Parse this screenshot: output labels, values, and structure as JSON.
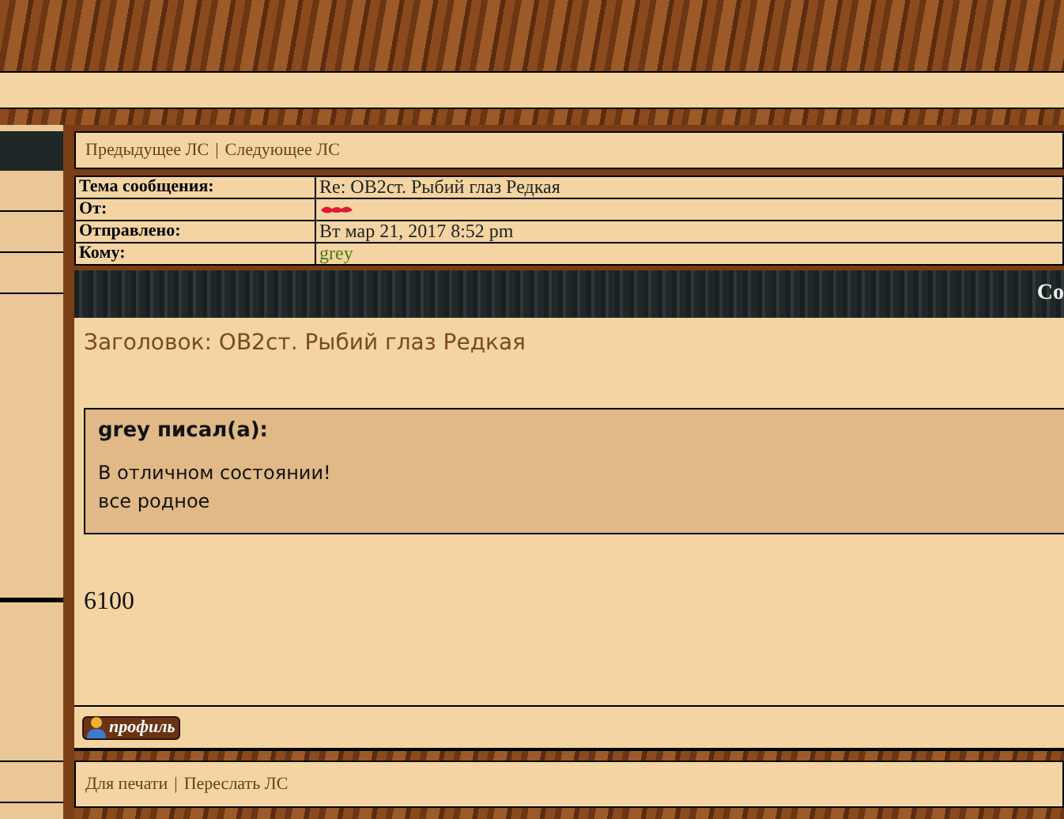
{
  "nav_links": [
    "Предыдущее ЛС",
    "Следующее ЛС"
  ],
  "nav_separator": "|",
  "header_fields": [
    {
      "label": "Тема сообщения:",
      "value": "Re: OB2ст. Рыбий глаз Редкая",
      "kind": "text"
    },
    {
      "label": "От:",
      "kind": "redacted"
    },
    {
      "label": "Отправлено:",
      "value": "Вт мар 21, 2017 8:52 pm",
      "kind": "text"
    },
    {
      "label": "Кому:",
      "value": "grey",
      "kind": "user"
    }
  ],
  "post_bar": {
    "title": "Со"
  },
  "post": {
    "subject": "Заголовок: OB2ст. Рыбий глаз Редкая",
    "quote": {
      "author": "grey писал(а):",
      "lines": [
        "В отличном состоянии!",
        "все родное"
      ]
    },
    "text": "6100"
  },
  "profile_button": {
    "label": "профиль"
  },
  "footer_links": [
    "Для печати",
    "Переслать ЛС"
  ],
  "footer_separator": "|"
}
